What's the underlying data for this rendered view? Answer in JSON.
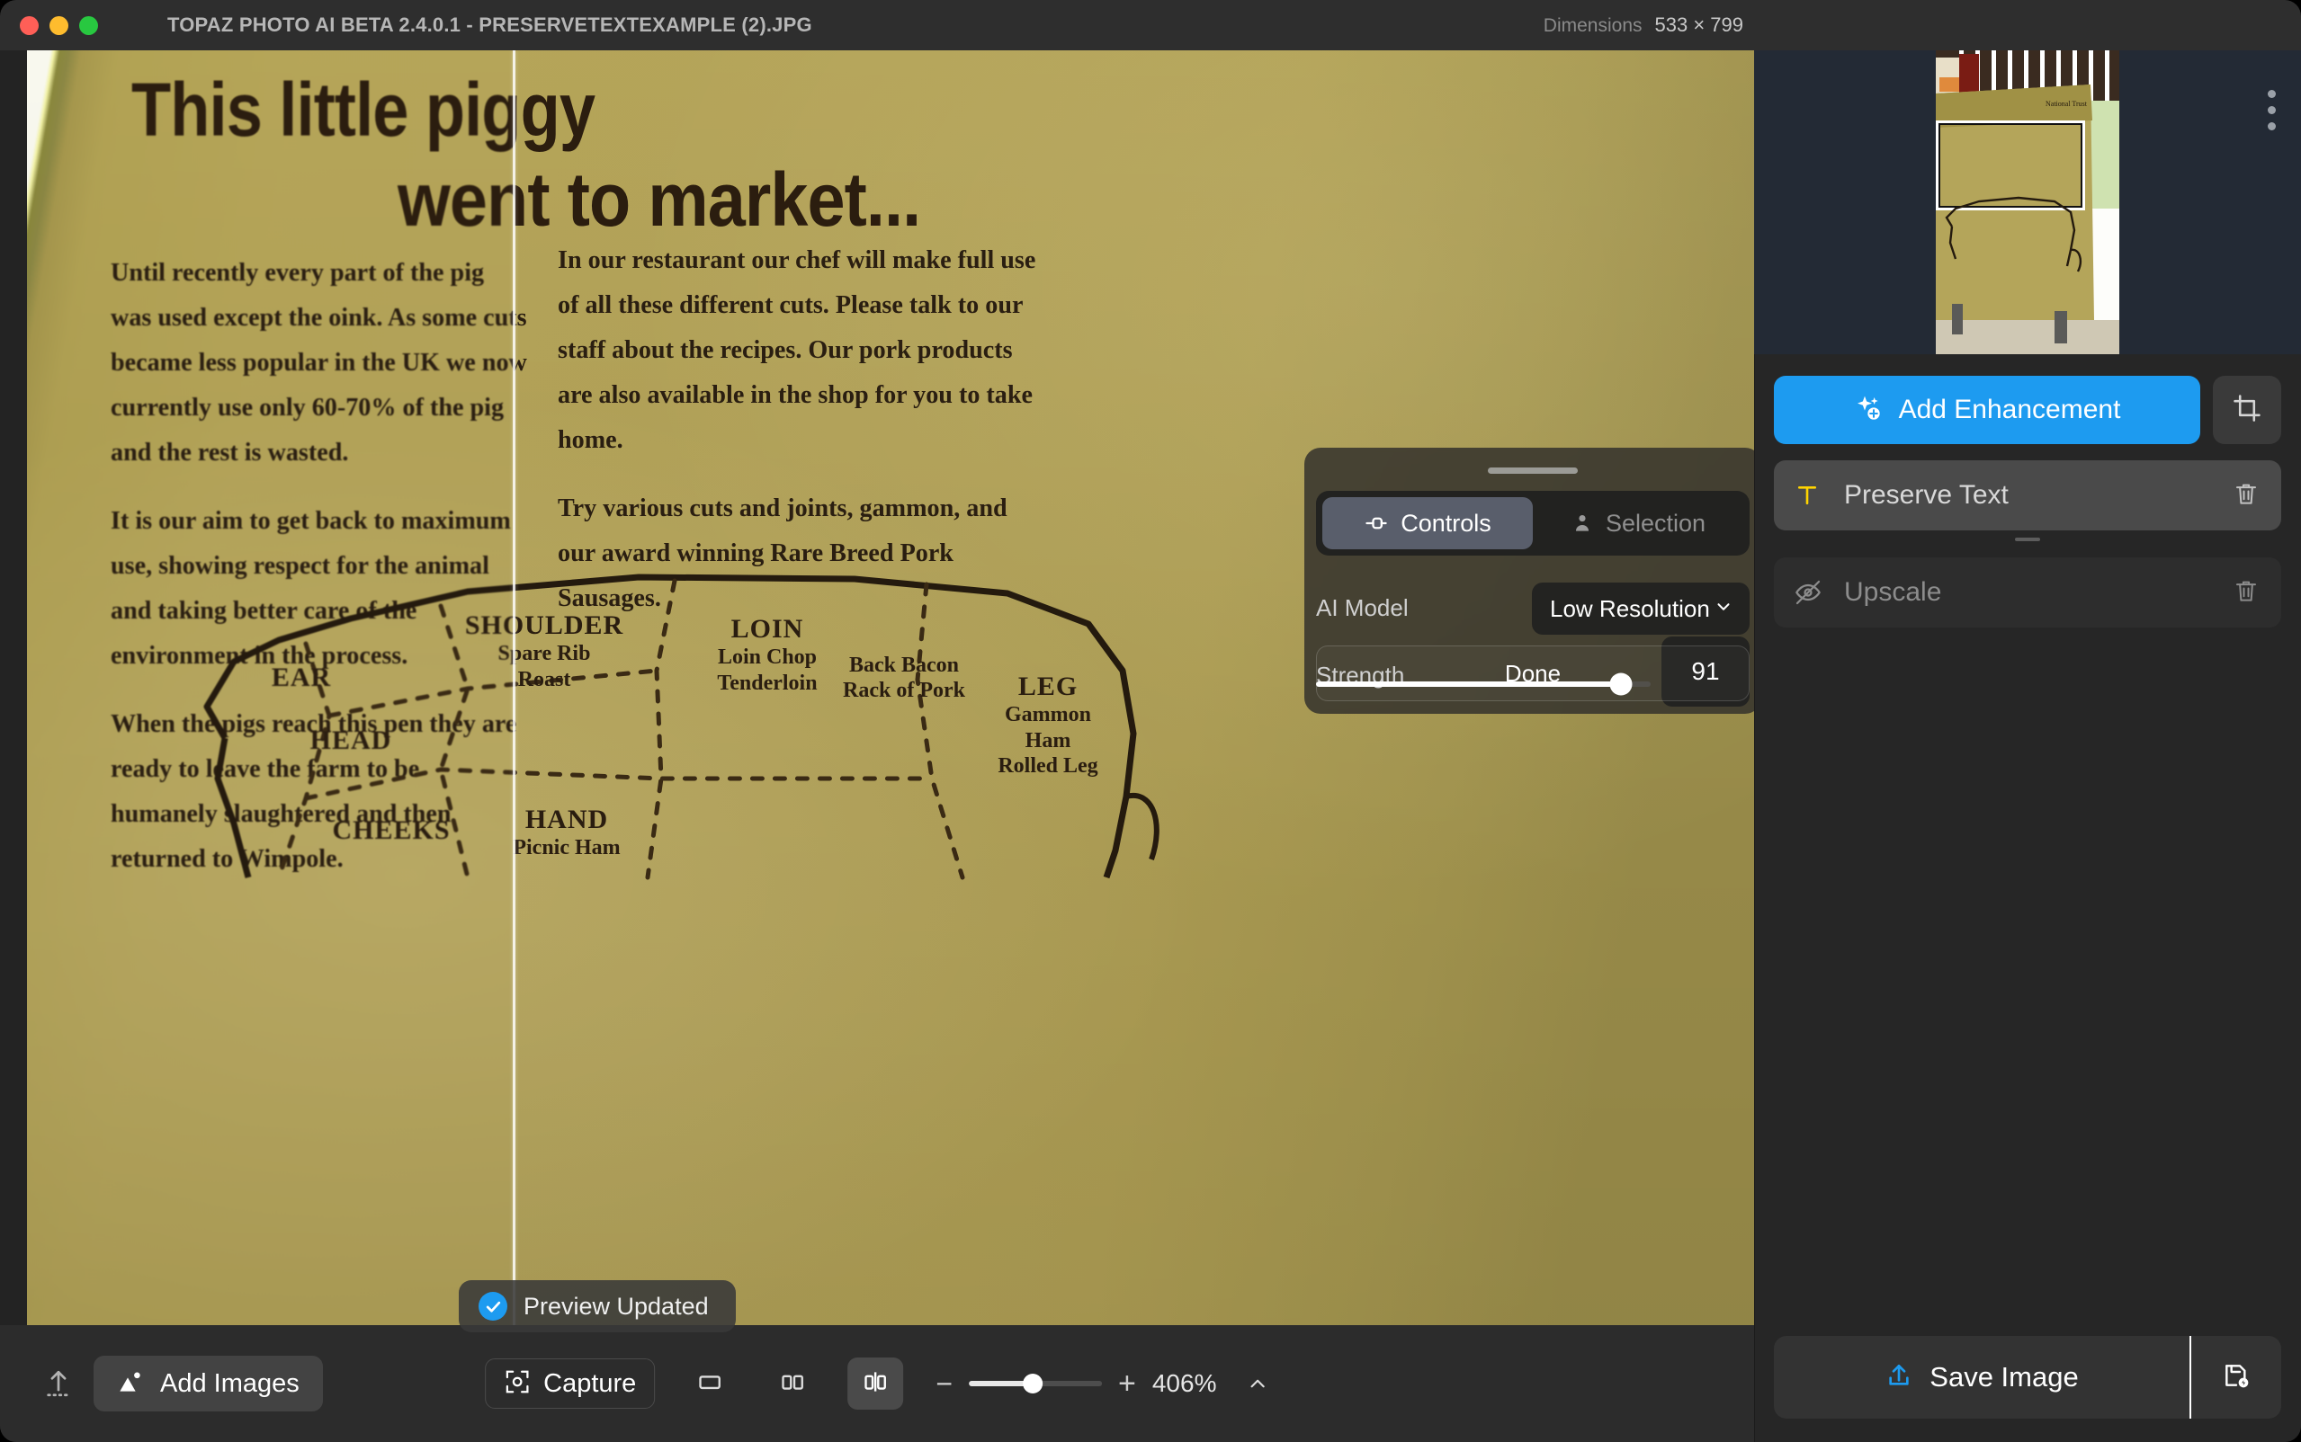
{
  "window": {
    "title": "TOPAZ PHOTO AI BETA 2.4.0.1 - PRESERVETEXTEXAMPLE (2).JPG",
    "dimensions_label": "Dimensions",
    "dimensions_value": "533 × 799",
    "traffic_lights": [
      "close-red",
      "minimize-yellow",
      "maximize-green"
    ]
  },
  "image_content": {
    "headline_line1": "This little piggy",
    "headline_line2": "went to market...",
    "left_column": [
      "Until recently every part of the pig was used except the oink. As some cuts became less popular in the UK we now currently use only 60-70% of the pig and the rest is wasted.",
      "It is our aim to get back to maximum use, showing respect for the animal and taking better care of the environment in the process.",
      "When the pigs reach this pen they are ready to leave the farm to be humanely slaughtered and then returned to Wimpole."
    ],
    "right_column": [
      "In our restaurant our chef will make full use of all these different cuts. Please talk to our staff about the recipes. Our pork products are also available in the shop for you to take home.",
      "Try various cuts and joints, gammon, and our award winning Rare Breed Pork Sausages."
    ],
    "diagram_labels": [
      {
        "title": "EAR",
        "sub": ""
      },
      {
        "title": "HEAD",
        "sub": ""
      },
      {
        "title": "CHEEKS",
        "sub": ""
      },
      {
        "title": "SHOULDER",
        "sub": "Spare Rib\nRoast"
      },
      {
        "title": "HAND",
        "sub": "Picnic Ham"
      },
      {
        "title": "LOIN",
        "sub": "Loin Chop\nTenderloin"
      },
      {
        "title": "",
        "sub": "Back Bacon\nRack of Pork"
      },
      {
        "title": "LEG",
        "sub": "Gammon\nHam\nRolled Leg"
      }
    ],
    "watermark": "National Trust"
  },
  "controls_panel": {
    "tabs": [
      {
        "label": "Controls",
        "icon": "tune-icon",
        "active": true
      },
      {
        "label": "Selection",
        "icon": "person-selection-icon",
        "active": false
      }
    ],
    "ai_model_label": "AI Model",
    "ai_model_value": "Low Resolution",
    "ai_model_options": [
      "Low Resolution"
    ],
    "strength_label": "Strength",
    "strength_value": "91",
    "strength_percent": 91,
    "done_label": "Done"
  },
  "toast": {
    "message": "Preview Updated",
    "icon": "check-circle-icon",
    "accent": "#1d9bf0"
  },
  "toolbar": {
    "export_icon": "upload-arrow-icon",
    "add_images_label": "Add Images",
    "add_images_icon": "image-icon",
    "capture_label": "Capture",
    "capture_icon": "camera-frame-icon",
    "view_modes": [
      {
        "name": "single-view",
        "icon": "single-pane-icon",
        "active": false
      },
      {
        "name": "side-by-side-view",
        "icon": "double-pane-icon",
        "active": false
      },
      {
        "name": "split-compare-view",
        "icon": "split-compare-icon",
        "active": true
      }
    ],
    "zoom_minus": "−",
    "zoom_plus": "+",
    "zoom_value": "406%",
    "zoom_percent": 48,
    "zoom_chevron": "chevron-up-icon"
  },
  "sidebar": {
    "kebab_icon": "more-vertical-icon",
    "add_enhancement_label": "Add Enhancement",
    "add_enhancement_icon": "sparkle-plus-icon",
    "crop_icon": "crop-icon",
    "enhancements": [
      {
        "label": "Preserve Text",
        "icon": "text-t-icon",
        "icon_color": "#ffd400",
        "state": "selected",
        "delete_icon": "trash-icon"
      },
      {
        "label": "Upscale",
        "icon": "eye-off-icon",
        "icon_color": "#8c8c8c",
        "state": "disabled",
        "delete_icon": "trash-icon"
      }
    ],
    "save_label": "Save Image",
    "save_icon": "upload-box-icon",
    "save_options_icon": "save-as-icon",
    "accent": "#1d9bf0"
  }
}
